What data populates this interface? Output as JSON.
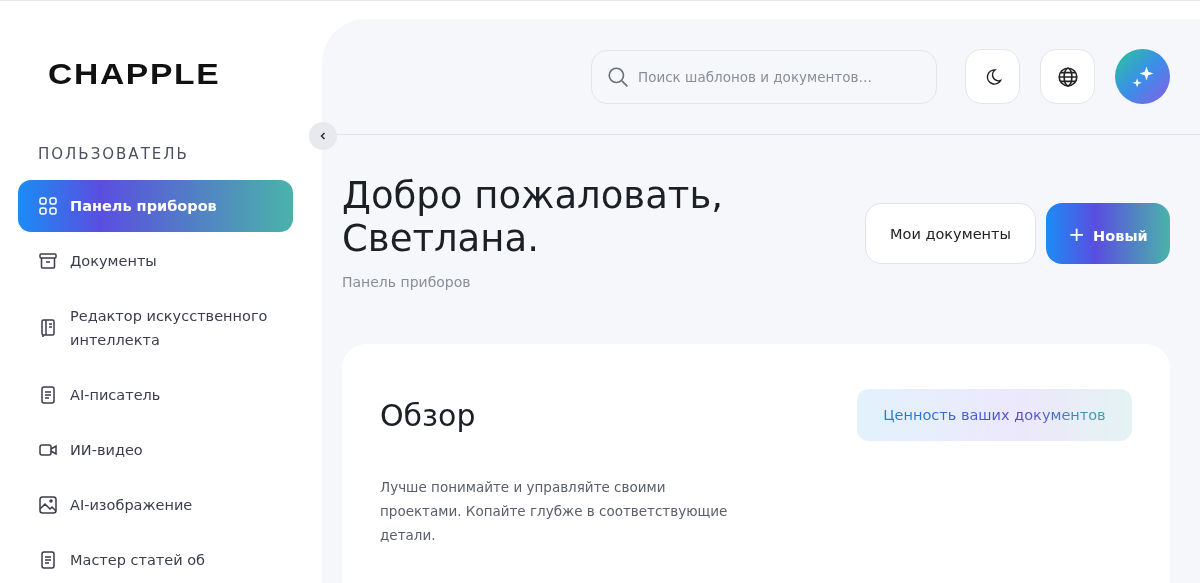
{
  "logo": "CHAPPLE",
  "sidebar": {
    "section": "ПОЛЬЗОВАТЕЛЬ",
    "items": [
      {
        "label": "Панель приборов",
        "selected": true
      },
      {
        "label": "Документы",
        "selected": false
      },
      {
        "label": "Редактор искусственного интеллекта",
        "selected": false
      },
      {
        "label": "AI-писатель",
        "selected": false
      },
      {
        "label": "ИИ-видео",
        "selected": false
      },
      {
        "label": "AI-изображение",
        "selected": false
      },
      {
        "label": "Мастер статей об",
        "selected": false
      }
    ]
  },
  "search": {
    "placeholder": "Поиск шаблонов и документов…"
  },
  "header": {
    "title": "Добро пожаловать, Светлана.",
    "breadcrumb": "Панель приборов",
    "buttons": [
      {
        "label": "Мои документы",
        "kind": "outline"
      },
      {
        "label": "Новый",
        "kind": "primary",
        "icon": "+"
      }
    ]
  },
  "overview": {
    "title": "Обзор",
    "badge": "Ценность ваших документов",
    "description": "Лучше понимайте и управляйте своими проектами. Копайте глубже в соответствующие детали."
  }
}
